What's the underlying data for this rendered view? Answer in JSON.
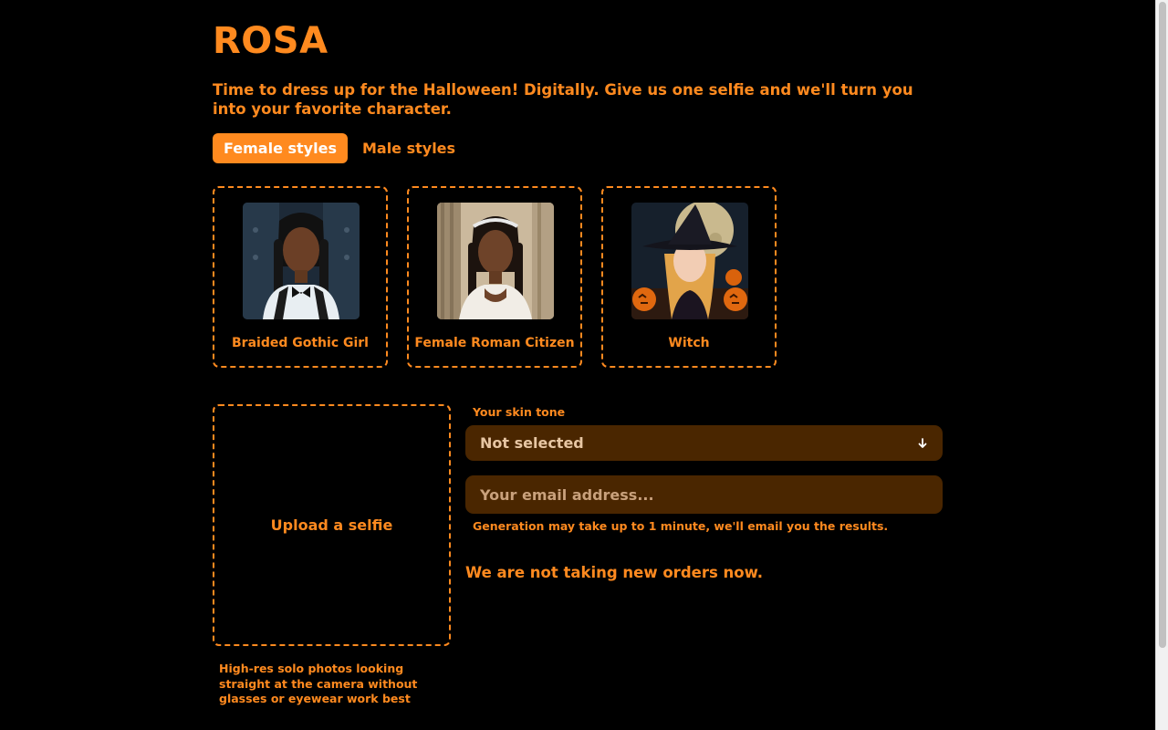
{
  "header": {
    "brand": "ROSA",
    "tagline": "Time to dress up for the Halloween! Digitally. Give us one selfie and we'll turn you into your favorite character."
  },
  "tabs": [
    {
      "label": "Female styles",
      "active": true
    },
    {
      "label": "Male styles",
      "active": false
    }
  ],
  "styles": [
    {
      "label": "Braided Gothic Girl",
      "icon": "gothic-girl-portrait"
    },
    {
      "label": "Female Roman Citizen",
      "icon": "roman-citizen-portrait"
    },
    {
      "label": "Witch",
      "icon": "witch-portrait"
    }
  ],
  "upload": {
    "label": "Upload a selfie",
    "hint": "High-res solo photos looking straight at the camera without glasses or eyewear work best"
  },
  "form": {
    "skin_tone_label": "Your skin tone",
    "skin_tone_value": "Not selected",
    "email_placeholder": "Your email address...",
    "generation_note": "Generation may take up to 1 minute, we'll email you the results.",
    "closed_message": "We are not taking new orders now."
  },
  "colors": {
    "accent": "#ff8a1f",
    "background": "#000000",
    "field_bg": "#4a2600",
    "field_text": "#e7c6a3"
  }
}
